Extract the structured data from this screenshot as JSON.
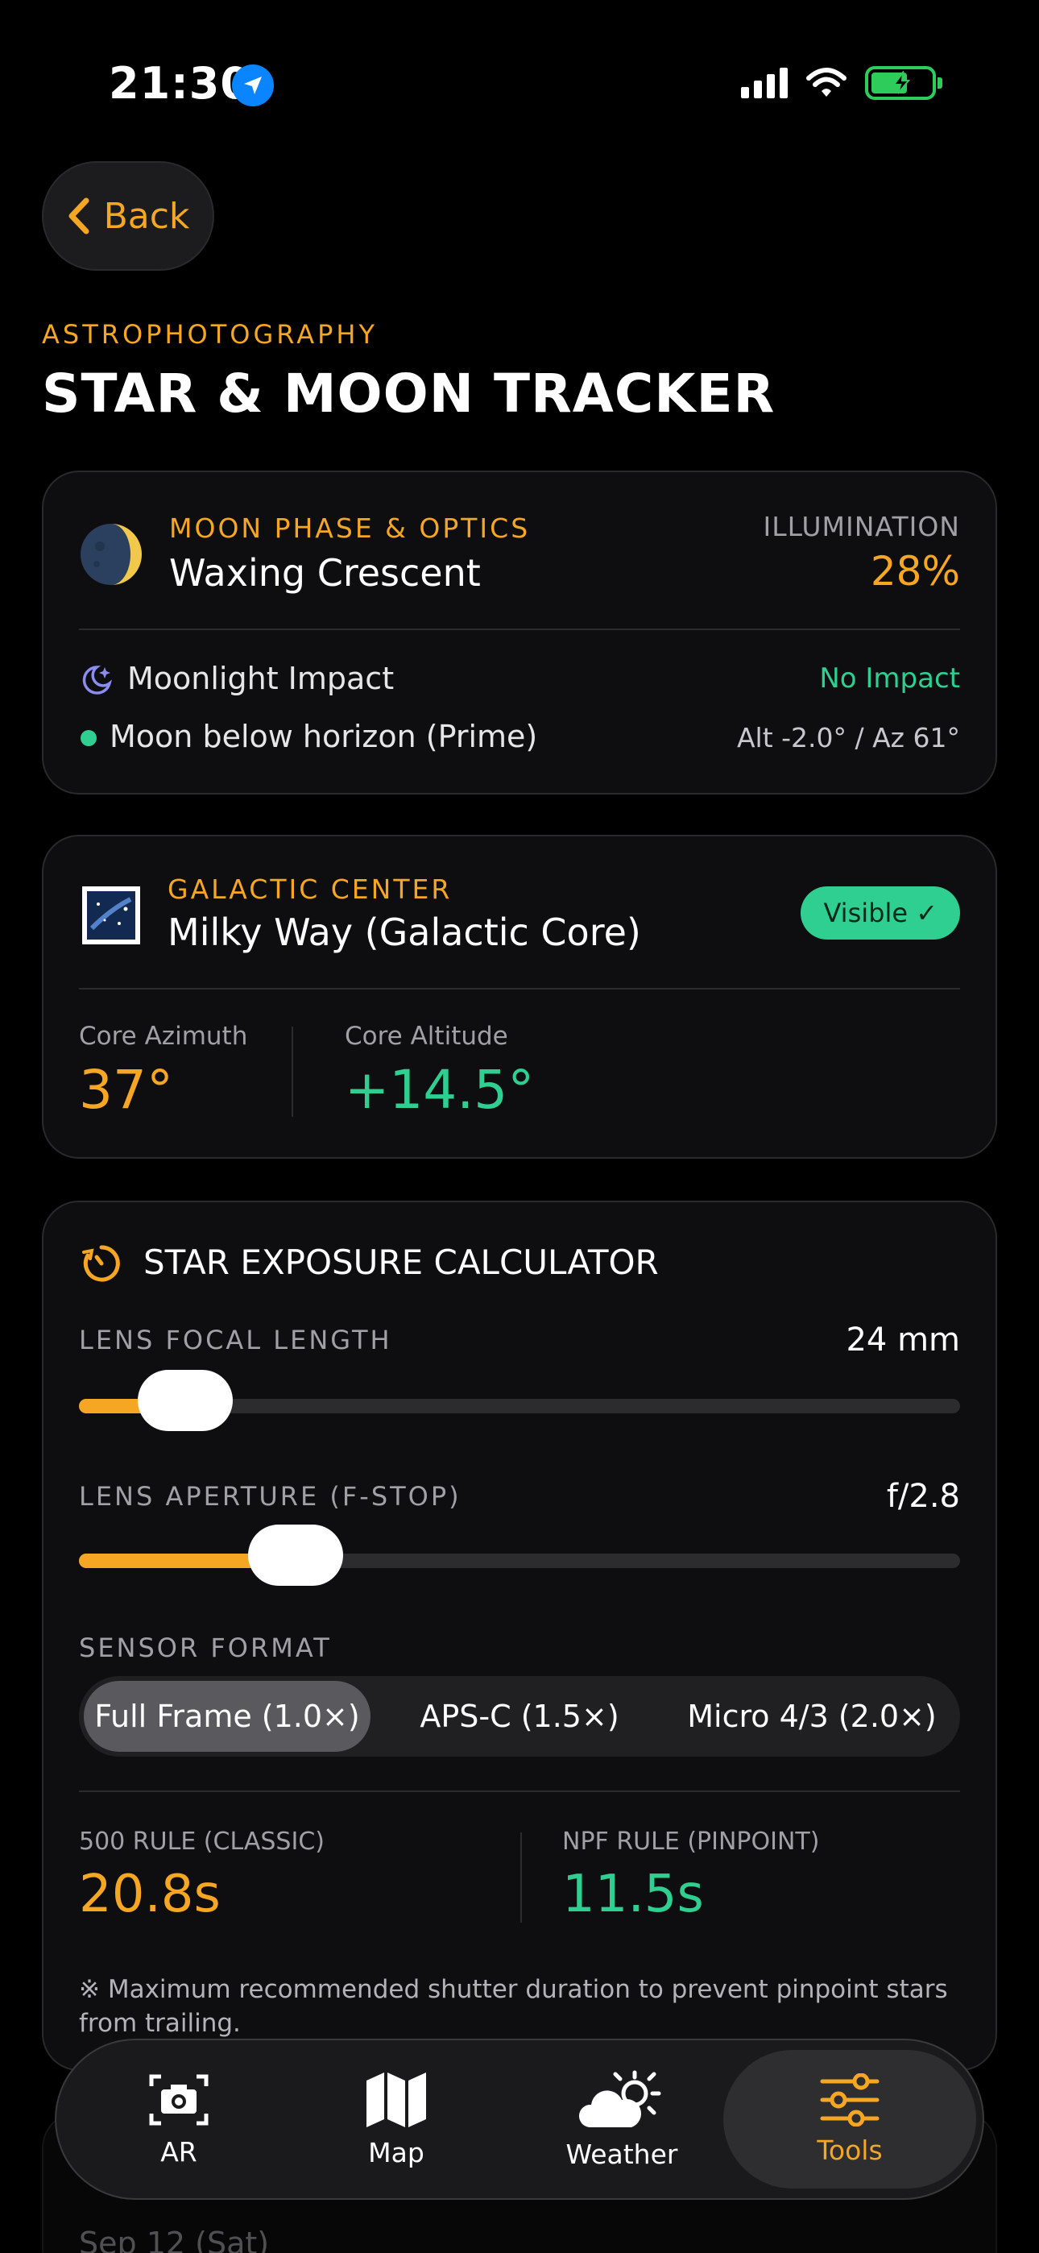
{
  "status": {
    "time": "21:30"
  },
  "header": {
    "back_label": "Back",
    "kicker": "ASTROPHOTOGRAPHY",
    "title": "STAR & MOON TRACKER"
  },
  "moon_card": {
    "label": "MOON PHASE & OPTICS",
    "phase": "Waxing Crescent",
    "illum_label": "ILLUMINATION",
    "illum_value": "28%",
    "impact_label": "Moonlight Impact",
    "impact_value": "No Impact",
    "horizon_text": "Moon below horizon (Prime)",
    "position": "Alt -2.0° / Az 61°"
  },
  "core_card": {
    "label": "GALACTIC CENTER",
    "name": "Milky Way (Galactic Core)",
    "badge": "Visible ✓",
    "az_label": "Core Azimuth",
    "az_value": "37°",
    "alt_label": "Core Altitude",
    "alt_value": "+14.5°"
  },
  "calc_card": {
    "title": "STAR EXPOSURE CALCULATOR",
    "focal_label": "LENS FOCAL LENGTH",
    "focal_value": "24 mm",
    "focal_fraction": 0.12,
    "aperture_label": "LENS APERTURE (F-STOP)",
    "aperture_value": "f/2.8",
    "aperture_fraction": 0.245,
    "sensor_label": "SENSOR FORMAT",
    "sensor_options": [
      "Full Frame (1.0×)",
      "APS-C (1.5×)",
      "Micro 4/3 (2.0×)"
    ],
    "sensor_selected": "Full Frame (1.0×)",
    "rule500_label": "500 RULE (CLASSIC)",
    "rule500_value": "20.8s",
    "npf_label": "NPF RULE (PINPOINT)",
    "npf_value": "11.5s",
    "note": "※ Maximum recommended shutter duration to prevent pinpoint stars from trailing."
  },
  "behind_card": {
    "date": "Sep 12 (Sat)"
  },
  "tabs": [
    {
      "label": "AR",
      "icon": "camera-icon"
    },
    {
      "label": "Map",
      "icon": "map-icon"
    },
    {
      "label": "Weather",
      "icon": "weather-icon"
    },
    {
      "label": "Tools",
      "icon": "sliders-icon",
      "active": true
    }
  ],
  "colors": {
    "accent": "#f5a623",
    "success": "#2fcf91",
    "background": "#000000",
    "card": "#0e0e10"
  }
}
